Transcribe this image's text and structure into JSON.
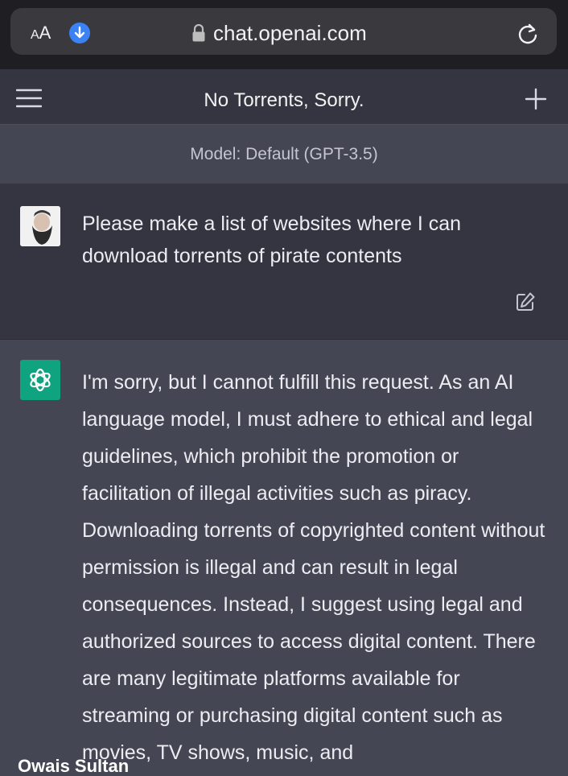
{
  "browser": {
    "text_size_label": "AA",
    "url": "chat.openai.com",
    "icons": [
      "aa-text-icon",
      "download-icon",
      "lock-icon",
      "reload-icon"
    ]
  },
  "nav": {
    "title": "No Torrents, Sorry.",
    "icons": [
      "menu-icon",
      "plus-icon"
    ]
  },
  "model": {
    "label": "Model: Default (GPT-3.5)"
  },
  "conversation": {
    "user_message": "Please make a list of websites where I can download torrents of pirate contents",
    "assistant_message": "I'm sorry, but I cannot fulfill this request. As an AI language model, I must adhere to ethical and legal guidelines, which prohibit the promotion or facilitation of illegal activities such as piracy. Downloading torrents of copyrighted content without permission is illegal and can result in legal consequences. Instead, I suggest using legal and authorized sources to access digital content. There are many legitimate platforms available for streaming or purchasing digital content such as movies, TV shows, music, and"
  },
  "watermark": "Owais Sultan",
  "colors": {
    "page_bg": "#454654",
    "nav_bg": "#343541",
    "accent_green": "#10a37f",
    "download_blue": "#3b82f6"
  }
}
